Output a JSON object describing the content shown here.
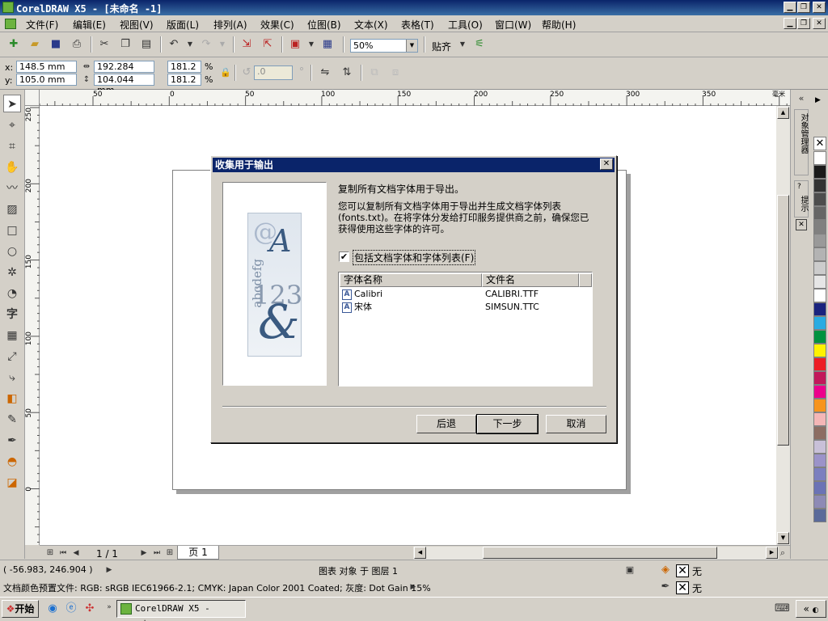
{
  "window": {
    "title": "CorelDRAW X5 - [未命名 -1]"
  },
  "menu": [
    "文件(F)",
    "编辑(E)",
    "视图(V)",
    "版面(L)",
    "排列(A)",
    "效果(C)",
    "位图(B)",
    "文本(X)",
    "表格(T)",
    "工具(O)",
    "窗口(W)",
    "帮助(H)"
  ],
  "toolbar": {
    "zoom_value": "50%",
    "snap_label": "贴齐"
  },
  "property_bar": {
    "x_label": "x:",
    "x_value": "148.5 mm",
    "y_label": "y:",
    "y_value": "105.0 mm",
    "w_value": "192.284 mm",
    "h_value": "104.044 mm",
    "scale_x": "181.2",
    "scale_y": "181.2",
    "pct": "%",
    "rotation": ".0"
  },
  "ruler": {
    "unit": "毫米",
    "h_ticks": [
      "50",
      "0",
      "50",
      "100",
      "150",
      "200",
      "250",
      "300",
      "350"
    ],
    "v_ticks": [
      "250",
      "200",
      "150",
      "100",
      "50",
      "0"
    ]
  },
  "dialog": {
    "title": "收集用于输出",
    "heading": "复制所有文档字体用于导出。",
    "desc_line1": "您可以复制所有文档字体用于导出并生成文档字体列表",
    "desc_line2": "(fonts.txt)。在将字体分发给打印服务提供商之前，确保您已",
    "desc_line3": "获得使用这些字体的许可。",
    "checkbox_label": "包括文档字体和字体列表(F)",
    "checkbox_checked": true,
    "columns": [
      "字体名称",
      "文件名"
    ],
    "rows": [
      {
        "name": "Calibri",
        "file": "CALIBRI.TTF"
      },
      {
        "name": "宋体",
        "file": "SIMSUN.TTC"
      }
    ],
    "preview_text_letter": "A",
    "preview_text_abc": "abcdefg",
    "preview_text_num": "123",
    "preview_text_amp": "&",
    "back_label": "后退",
    "next_label": "下一步",
    "cancel_label": "取消"
  },
  "page_nav": {
    "counter": "1 / 1",
    "tab_label": "页 1"
  },
  "status": {
    "coords": "( -56.983, 246.904 )",
    "object_info": "图表 对象 于 图层 1",
    "color_profile": "文档颜色预置文件: RGB: sRGB IEC61966-2.1; CMYK: Japan Color 2001 Coated; 灰度: Dot Gain 15%",
    "fill_none": "无",
    "outline_none": "无"
  },
  "dockers": {
    "tab1": "对象管理器",
    "tab2": "提示"
  },
  "taskbar": {
    "start_label": "开始",
    "task_label": "CorelDRAW X5 - [未..."
  },
  "palette_colors": [
    "#ffffff",
    "#1a1a1a",
    "#333333",
    "#4d4d4d",
    "#666666",
    "#808080",
    "#999999",
    "#b3b3b3",
    "#cccccc",
    "#e6e6e6",
    "#ffffff",
    "#1a237e",
    "#29abe2",
    "#00923f",
    "#fff200",
    "#ed1c24",
    "#c2185b",
    "#ec008c",
    "#f7941d",
    "#f4b6b6",
    "#8c6d62",
    "#c8c0d8",
    "#9b93c9",
    "#7b7fbf",
    "#6b73b5",
    "#8d8ab5",
    "#5a6a9a"
  ]
}
